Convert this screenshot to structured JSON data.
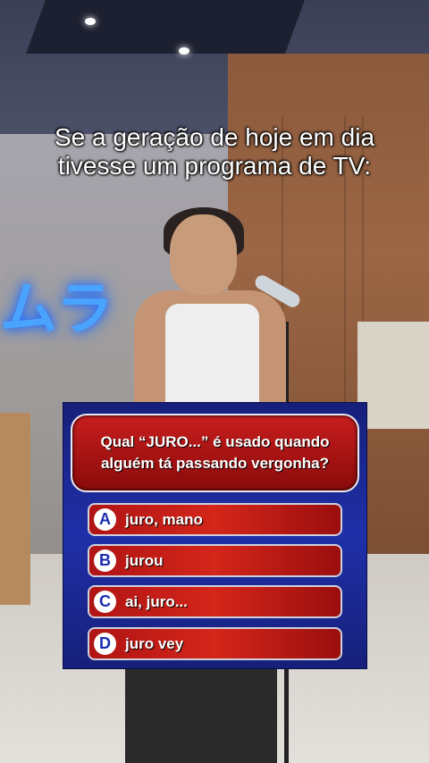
{
  "caption": {
    "line1": "Se a geração de hoje em dia",
    "line2": "tivesse um programa de TV:"
  },
  "scene": {
    "neon_sign": "ムラ"
  },
  "quiz": {
    "question_line1": "Qual “JURO...” é usado quando",
    "question_line2": "alguém tá passando vergonha?",
    "answers": [
      {
        "letter": "A",
        "text": "juro, mano"
      },
      {
        "letter": "B",
        "text": "jurou"
      },
      {
        "letter": "C",
        "text": "ai, juro..."
      },
      {
        "letter": "D",
        "text": "juro vey"
      }
    ]
  }
}
